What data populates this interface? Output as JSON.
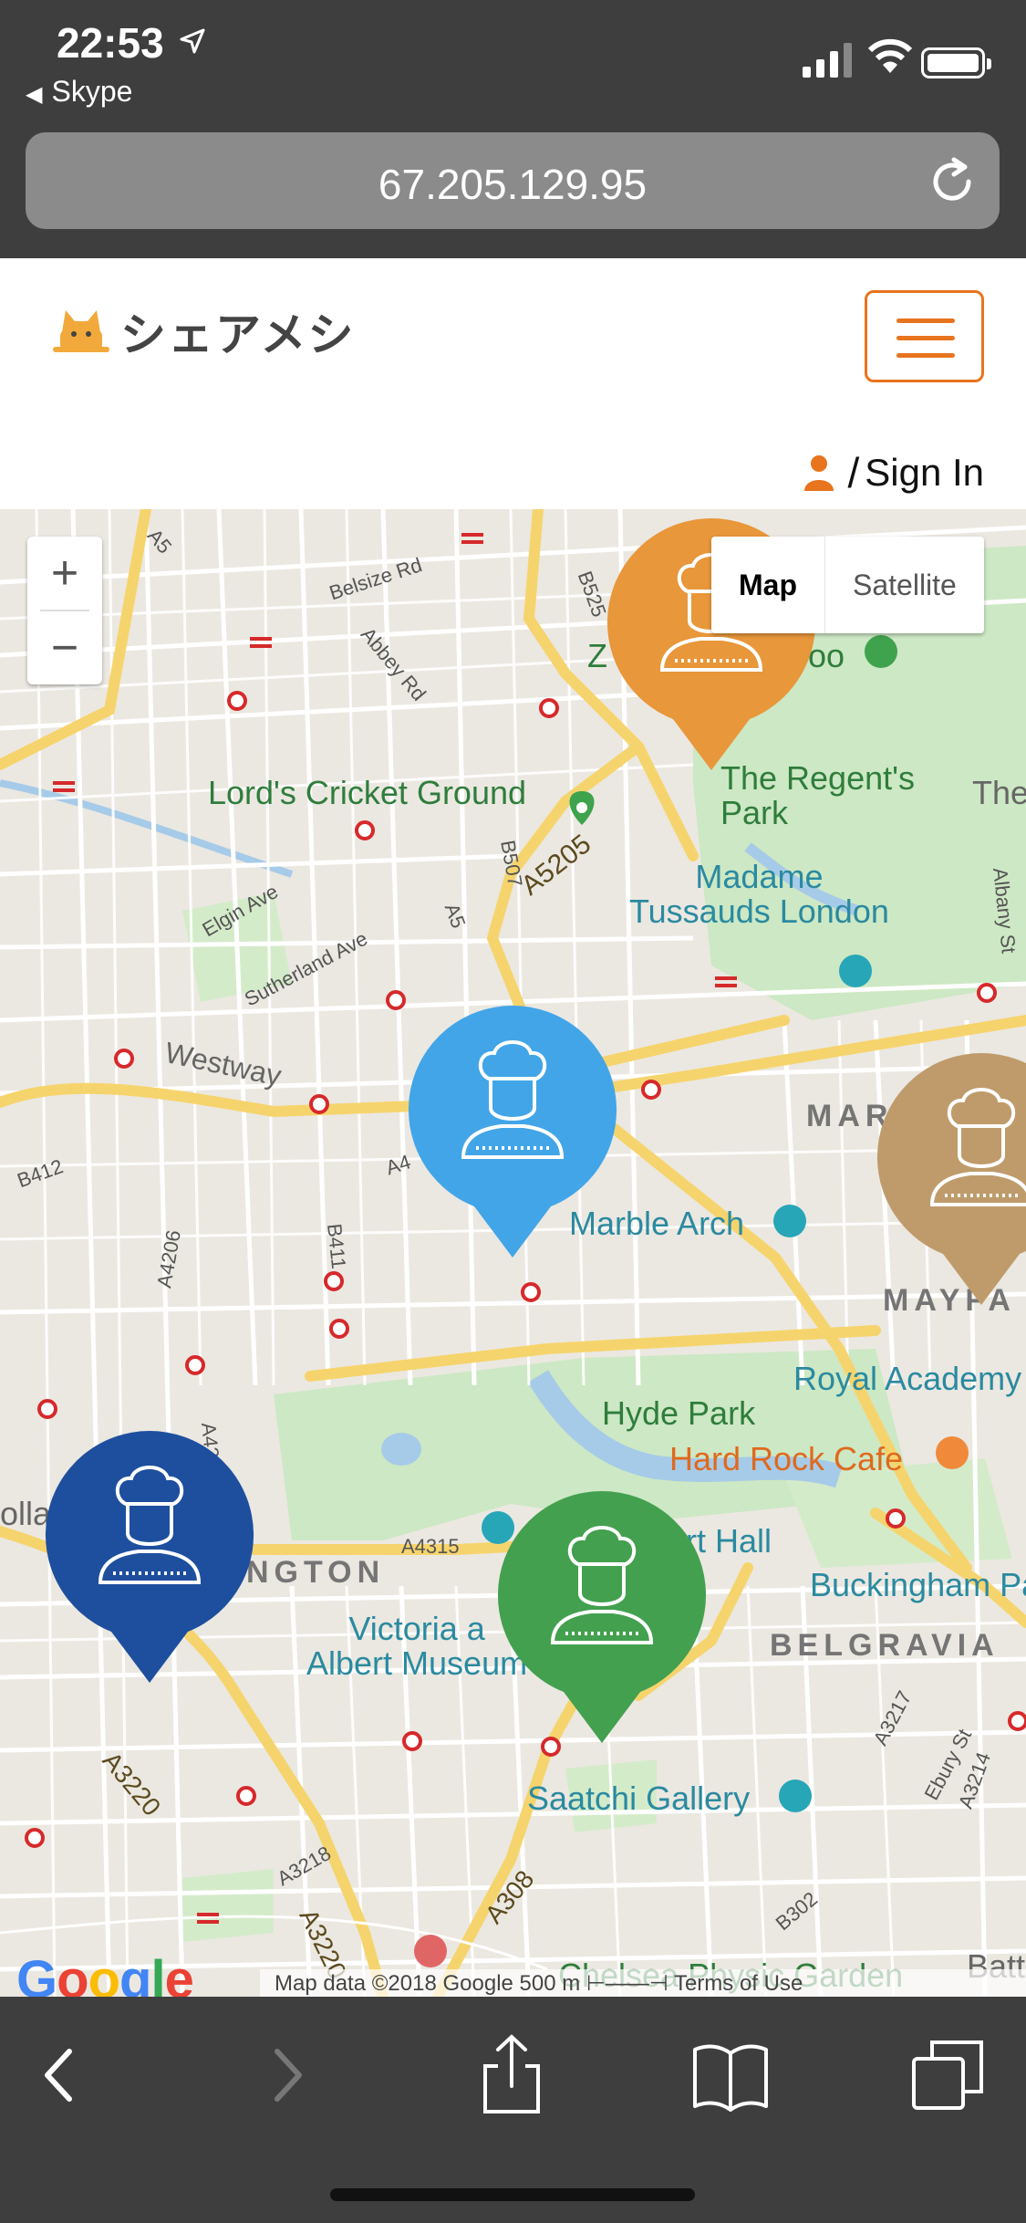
{
  "status_bar": {
    "time": "22:53",
    "back_app": "Skype"
  },
  "browser": {
    "url": "67.205.129.95"
  },
  "site": {
    "logo_text": "シェアメシ",
    "signin_slash": "/",
    "signin_label": "Sign In",
    "accent_color": "#e8741e"
  },
  "map": {
    "zoom_in": "+",
    "zoom_out": "−",
    "type_map": "Map",
    "type_satellite": "Satellite",
    "labels": {
      "lords": "Lord's Cricket Ground",
      "regents": "The Regent's\nPark",
      "madame": "Madame\nTussauds London",
      "marble": "Marble Arch",
      "royal": "Royal Academy",
      "hyde": "Hyde Park",
      "hardrock": "Hard Rock Cafe",
      "hall": "rt Hall",
      "buckingham": "Buckingham Pa",
      "belgravia": "BELGRAVIA",
      "victoria": "Victoria a\nAlbert Museum",
      "saatchi": "Saatchi Gallery",
      "chelsea": "Chelsea Physic Garden",
      "mar": "MAR",
      "mayfair": "MAYFA",
      "ngton": "NGTON",
      "zoo_z": "Z",
      "zoo": "oo",
      "the": "The",
      "holla": "olla",
      "batt": "Batt",
      "westway": "Westway"
    },
    "roads": {
      "belsize": "Belsize Rd",
      "abbey": "Abbey Rd",
      "a5205": "A5205",
      "b507": "B507",
      "a5": "A5",
      "elgin": "Elgin Ave",
      "sutherland": "Sutherland Ave",
      "b412": "B412",
      "a4206": "A4206",
      "b411": "B411",
      "a4204": "A4204",
      "a4": "A4",
      "a4315": "A4315",
      "a3220": "A3220",
      "a3220b": "A3220",
      "a3218": "A3218",
      "a308": "A308",
      "b302": "B302",
      "a3217": "A3217",
      "ebury": "Ebury St",
      "a3214": "A3214",
      "albany": "Albany St",
      "b525": "B525",
      "a5top": "A5"
    },
    "pins": [
      {
        "name": "orange",
        "color": "#e8973a"
      },
      {
        "name": "blue",
        "color": "#42a5e8"
      },
      {
        "name": "tan",
        "color": "#bf9b6c"
      },
      {
        "name": "navy",
        "color": "#1e4f9e"
      },
      {
        "name": "green",
        "color": "#43a04f"
      }
    ],
    "attribution": "Map data ©2018 Google   500 m ⊢——⊣   Terms of Use",
    "google": "Google"
  }
}
